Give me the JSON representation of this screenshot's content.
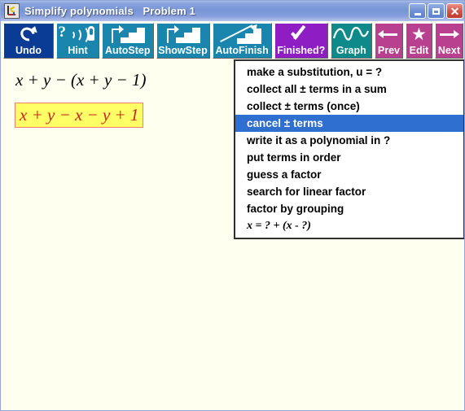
{
  "window": {
    "title": "Simplify polynomials   Problem 1",
    "icon": "app-icon",
    "controls": {
      "minimize": "–",
      "maximize": "□",
      "close": "✕"
    }
  },
  "toolbar": {
    "buttons": [
      {
        "id": "undo",
        "label": "Undo",
        "accel": "U",
        "icon": "undo-arrow-icon",
        "color": "#0a3c96",
        "state": "active"
      },
      {
        "id": "hint",
        "label": "Hint",
        "accel": "H",
        "icon": "question-sound-icon",
        "color": "#1a86ad",
        "state": "normal"
      },
      {
        "id": "autostep",
        "label": "AutoStep",
        "accel": "S",
        "icon": "stairs-arrow-icon",
        "color": "#1a86ad",
        "state": "normal"
      },
      {
        "id": "showstep",
        "label": "ShowStep",
        "accel": "w",
        "icon": "stairs-arrow-icon",
        "color": "#1a86ad",
        "state": "normal"
      },
      {
        "id": "autofinish",
        "label": "AutoFinish",
        "accel": "A",
        "icon": "stairs-diagonal-icon",
        "color": "#1a86ad",
        "state": "normal"
      },
      {
        "id": "finished",
        "label": "Finished?",
        "accel": "F",
        "icon": "checkmark-icon",
        "color": "#8e1ec4",
        "state": "normal"
      },
      {
        "id": "graph",
        "label": "Graph",
        "accel": "G",
        "icon": "curve-graph-icon",
        "color": "#0f8a8a",
        "state": "normal"
      },
      {
        "id": "prev",
        "label": "Prev",
        "accel": "P",
        "icon": "arrow-left-icon",
        "color": "#b9408f",
        "state": "normal"
      },
      {
        "id": "edit",
        "label": "Edit",
        "accel": "E",
        "icon": "star-icon",
        "color": "#b9408f",
        "state": "normal"
      },
      {
        "id": "next",
        "label": "Next",
        "accel": "N",
        "icon": "arrow-right-icon",
        "color": "#b9408f",
        "state": "normal"
      }
    ]
  },
  "work_area": {
    "background_color": "#fffff0",
    "expressions": [
      {
        "id": "line-1",
        "text": "x + y − (x + y − 1)",
        "selected": false
      },
      {
        "id": "line-2",
        "text": "x + y − x − y + 1",
        "selected": true,
        "highlight_background": "#ffff66",
        "highlight_border": "#f08070",
        "text_color": "#cc2020"
      }
    ]
  },
  "menu": {
    "selected_index": 3,
    "highlight_color": "#2f6fd0",
    "items": [
      {
        "label": "make a substitution, u = ?",
        "style": "text"
      },
      {
        "label": "collect all ± terms in a sum",
        "style": "text"
      },
      {
        "label": "collect ± terms (once)",
        "style": "text"
      },
      {
        "label": "cancel ± terms",
        "style": "text"
      },
      {
        "label": "write it as a polynomial in ?",
        "style": "text"
      },
      {
        "label": "put terms in order",
        "style": "text"
      },
      {
        "label": "guess a factor",
        "style": "text"
      },
      {
        "label": "search for linear factor",
        "style": "text"
      },
      {
        "label": "factor by grouping",
        "style": "text"
      },
      {
        "label": "x = ? + (x - ?)",
        "style": "math"
      }
    ]
  }
}
